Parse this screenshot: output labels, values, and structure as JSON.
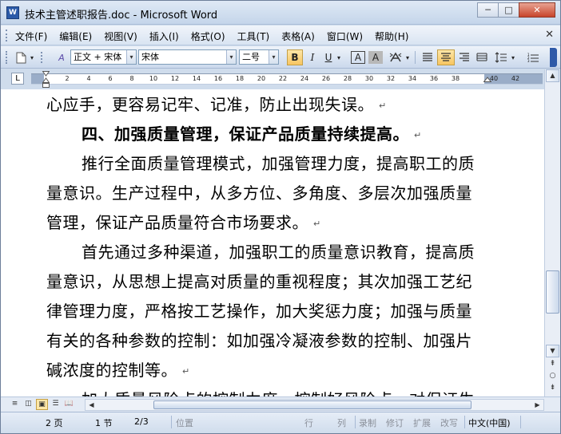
{
  "window": {
    "title": "技术主管述职报告.doc - Microsoft Word",
    "minimize": "─",
    "maximize": "□",
    "close": "✕"
  },
  "menu": {
    "items": [
      "文件(F)",
      "编辑(E)",
      "视图(V)",
      "插入(I)",
      "格式(O)",
      "工具(T)",
      "表格(A)",
      "窗口(W)",
      "帮助(H)"
    ],
    "close": "✕"
  },
  "toolbar": {
    "style_value": "正文 + 宋体",
    "font_value": "宋体",
    "size_value": "二号",
    "bold": "B",
    "italic": "I",
    "underline": "U",
    "char_border": "A",
    "char_shading": "A"
  },
  "ruler": {
    "corner": "L",
    "ticks": [
      "2",
      "4",
      "6",
      "8",
      "10",
      "12",
      "14",
      "16",
      "18",
      "20",
      "22",
      "24",
      "26",
      "28",
      "30",
      "32",
      "34",
      "36",
      "38",
      "40",
      "42"
    ]
  },
  "document": {
    "lines": [
      {
        "text": "心应手，更容易记牢、记准，防止出现失误。",
        "para_end": true
      },
      {
        "text": "四、加强质量管理，保证产品质量持续提高。",
        "para_end": true,
        "bold": true,
        "indent": true
      },
      {
        "text": "推行全面质量管理模式，加强管理力度，提高职工的质",
        "indent": true
      },
      {
        "text": "量意识。生产过程中，从多方位、多角度、多层次加强质量"
      },
      {
        "text": "管理，保证产品质量符合市场要求。",
        "para_end": true
      },
      {
        "text": "首先通过多种渠道，加强职工的质量意识教育，提高质",
        "indent": true
      },
      {
        "text": "量意识，从思想上提高对质量的重视程度；其次加强工艺纪"
      },
      {
        "text": "律管理力度，严格按工艺操作，加大奖惩力度；加强与质量"
      },
      {
        "text": "有关的各种参数的控制：如加强冷凝液参数的控制、加强片"
      },
      {
        "text": "碱浓度的控制等。",
        "para_end": true
      },
      {
        "text": "加大质量风险点的控制力度，控制好风险点，对保证生",
        "indent": true
      }
    ],
    "para_mark": "↵"
  },
  "status": {
    "page": "2 页",
    "section": "1 节",
    "page_of": "2/3",
    "position": "位置",
    "line": "行",
    "column": "列",
    "record": "录制",
    "revise": "修订",
    "extend": "扩展",
    "overtype": "改写",
    "language": "中文(中国)"
  }
}
